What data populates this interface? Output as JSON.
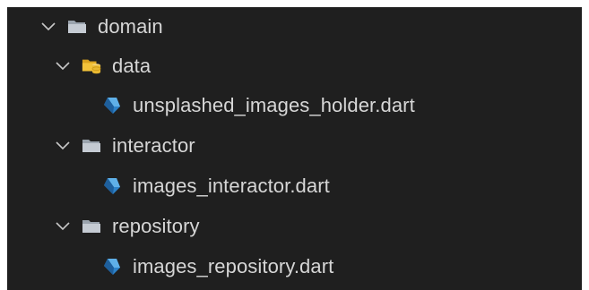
{
  "explorer": {
    "items": [
      {
        "label": "domain",
        "kind": "folder",
        "expanded": true,
        "icon": "folder-open-icon"
      },
      {
        "label": "data",
        "kind": "folder",
        "expanded": true,
        "icon": "database-folder-icon"
      },
      {
        "label": "unsplashed_images_holder.dart",
        "kind": "file",
        "icon": "dart-file-icon"
      },
      {
        "label": "interactor",
        "kind": "folder",
        "expanded": true,
        "icon": "folder-open-icon"
      },
      {
        "label": "images_interactor.dart",
        "kind": "file",
        "icon": "dart-file-icon"
      },
      {
        "label": "repository",
        "kind": "folder",
        "expanded": true,
        "icon": "folder-open-icon"
      },
      {
        "label": "images_repository.dart",
        "kind": "file",
        "icon": "dart-file-icon"
      }
    ]
  },
  "colors": {
    "background": "#1f1f1f",
    "text": "#d6d6d6",
    "folder": "#c5cbd3",
    "data_folder": "#e8b830",
    "dart": "#2c82c9"
  }
}
